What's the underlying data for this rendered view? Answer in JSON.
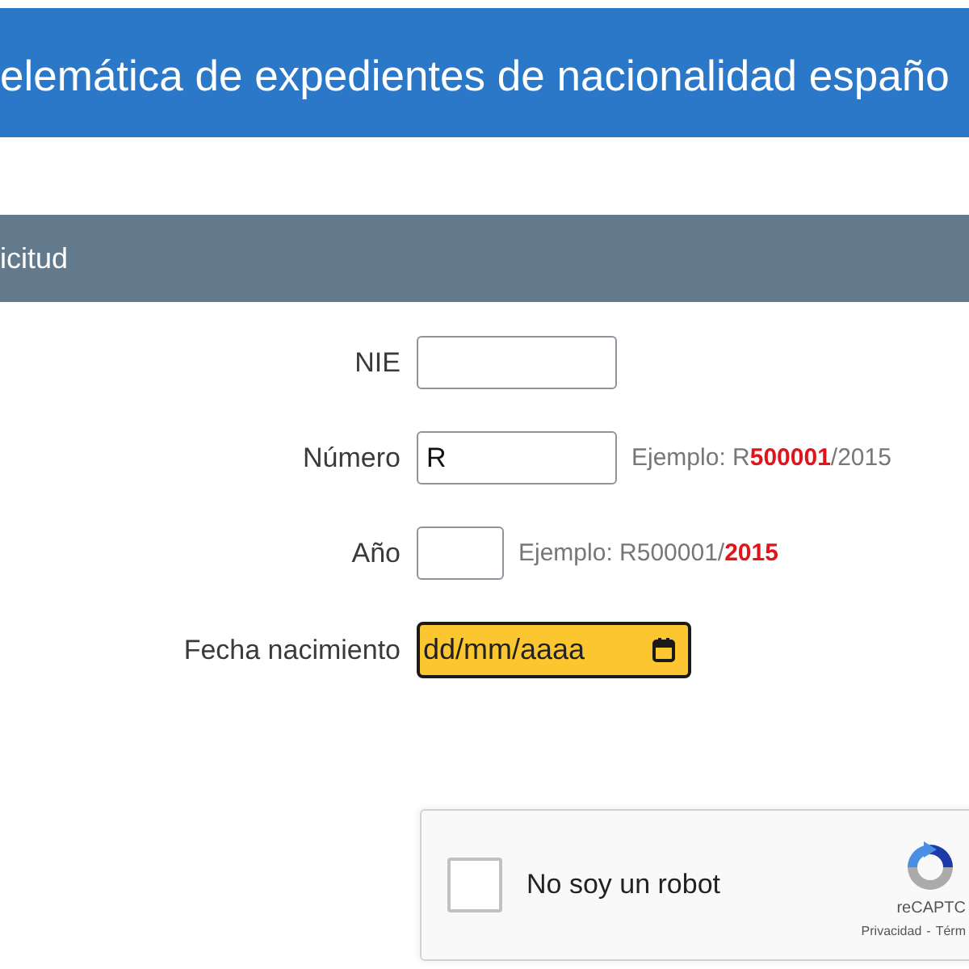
{
  "header": {
    "title": "elemática de expedientes de nacionalidad españo"
  },
  "section": {
    "title": "icitud"
  },
  "fields": [
    {
      "kind": "text",
      "label": "NIE"
    },
    {
      "kind": "text",
      "label": "Número",
      "value": "R",
      "hint": "Ejemplo: R**500001**/2015"
    },
    {
      "kind": "short",
      "label": "Año",
      "hint": "Ejemplo: R500001/**2015**"
    },
    {
      "kind": "date",
      "label": "Fecha nacimiento",
      "placeholder": "dd/mm/aaaa",
      "highlighted": true
    }
  ],
  "captcha": {
    "checked": false,
    "label": "No soy un robot",
    "brand": "reCAPTC",
    "privacy_link": "Privacidad",
    "separator": "-",
    "terms_link": "Térm"
  }
}
